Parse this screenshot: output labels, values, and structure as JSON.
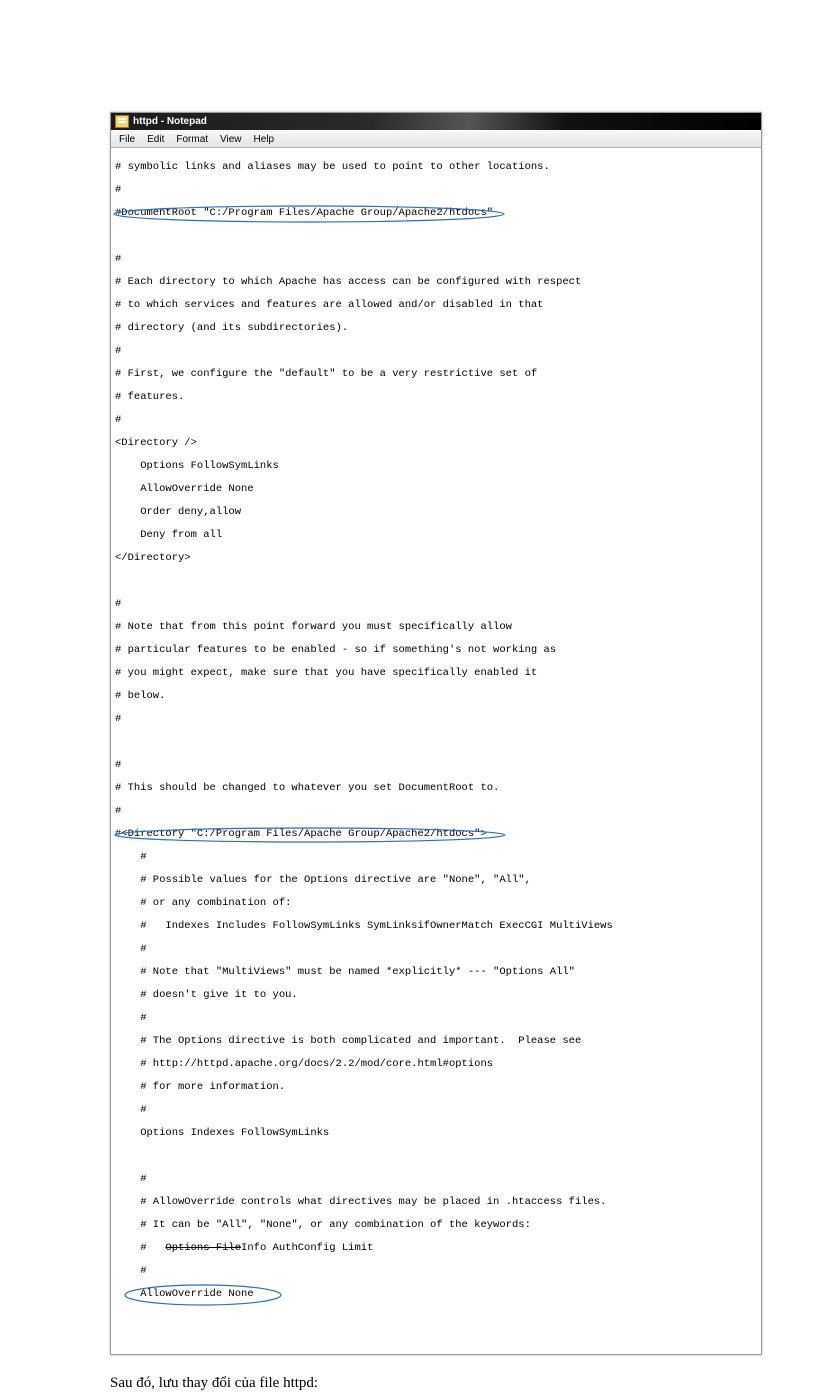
{
  "window": {
    "title": "httpd - Notepad",
    "menus": {
      "file": "File",
      "edit": "Edit",
      "format": "Format",
      "view": "View",
      "help": "Help"
    }
  },
  "lines": {
    "l0": "# symbolic links and aliases may be used to point to other locations.",
    "l1": "#",
    "l2": "#DocumentRoot \"C:/Program Files/Apache Group/Apache2/htdocs\"",
    "l3": "",
    "l4": "#",
    "l5": "# Each directory to which Apache has access can be configured with respect",
    "l6": "# to which services and features are allowed and/or disabled in that",
    "l7": "# directory (and its subdirectories).",
    "l8": "#",
    "l9": "# First, we configure the \"default\" to be a very restrictive set of",
    "l10": "# features.",
    "l11": "#",
    "l12": "<Directory />",
    "l13": "    Options FollowSymLinks",
    "l14": "    AllowOverride None",
    "l15": "    Order deny,allow",
    "l16": "    Deny from all",
    "l17": "</Directory>",
    "l18": "",
    "l19": "#",
    "l20": "# Note that from this point forward you must specifically allow",
    "l21": "# particular features to be enabled - so if something's not working as",
    "l22": "# you might expect, make sure that you have specifically enabled it",
    "l23": "# below.",
    "l24": "#",
    "l25": "",
    "l26": "#",
    "l27": "# This should be changed to whatever you set DocumentRoot to.",
    "l28": "#",
    "l29": "#<Directory \"C:/Program Files/Apache Group/Apache2/htdocs\">",
    "l30": "    #",
    "l31": "    # Possible values for the Options directive are \"None\", \"All\",",
    "l32": "    # or any combination of:",
    "l33": "    #   Indexes Includes FollowSymLinks SymLinksifOwnerMatch ExecCGI MultiViews",
    "l34": "    #",
    "l35": "    # Note that \"MultiViews\" must be named *explicitly* --- \"Options All\"",
    "l36": "    # doesn't give it to you.",
    "l37": "    #",
    "l38": "    # The Options directive is both complicated and important.  Please see",
    "l39": "    # http://httpd.apache.org/docs/2.2/mod/core.html#options",
    "l40": "    # for more information.",
    "l41": "    #",
    "l42": "    Options Indexes FollowSymLinks",
    "l43": "",
    "l44": "    #",
    "l45": "    # AllowOverride controls what directives may be placed in .htaccess files.",
    "l46": "    # It can be \"All\", \"None\", or any combination of the keywords:",
    "l47": "    #   Options FileInfo AuthConfig Limit",
    "l48": "    #",
    "l49": "    AllowOverride None",
    "l50": ""
  },
  "caption": "Sau đó, lưu thay đổi của file httpd:"
}
